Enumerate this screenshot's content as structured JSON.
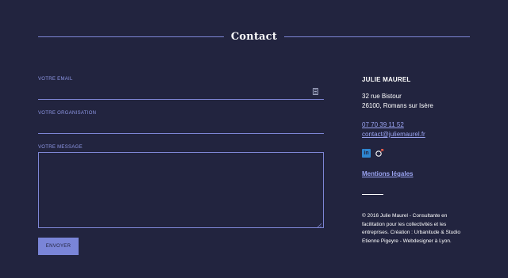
{
  "section": {
    "title": "Contact"
  },
  "form": {
    "email_label": "VOTRE EMAIL",
    "email_value": "",
    "organisation_label": "VOTRE ORGANISATION",
    "organisation_value": "",
    "message_label": "VOTRE MESSAGE",
    "message_value": "",
    "submit_label": "ENVOYER"
  },
  "contact": {
    "name": "JULIE MAUREL",
    "address_line1": "32 rue Bistour",
    "address_line2": "26100, Romans sur Isère",
    "phone": "07 70 39 11 52",
    "email": "contact@juliemaurel.fr",
    "social_icons": [
      "linkedin-icon",
      "venus-mars-icon"
    ],
    "legal_link": "Mentions légales",
    "copyright": "© 2016 Julie Maurel - Consultante en facilitation pour les collectivités et les entreprises. Création : Urbanitude & Studio Etienne Pigeyre - Webdesigner à Lyon."
  },
  "colors": {
    "background": "#22243f",
    "accent": "#7e86d6",
    "link": "#9aa3f0",
    "button": "#7a85d8",
    "text": "#ffffff"
  }
}
